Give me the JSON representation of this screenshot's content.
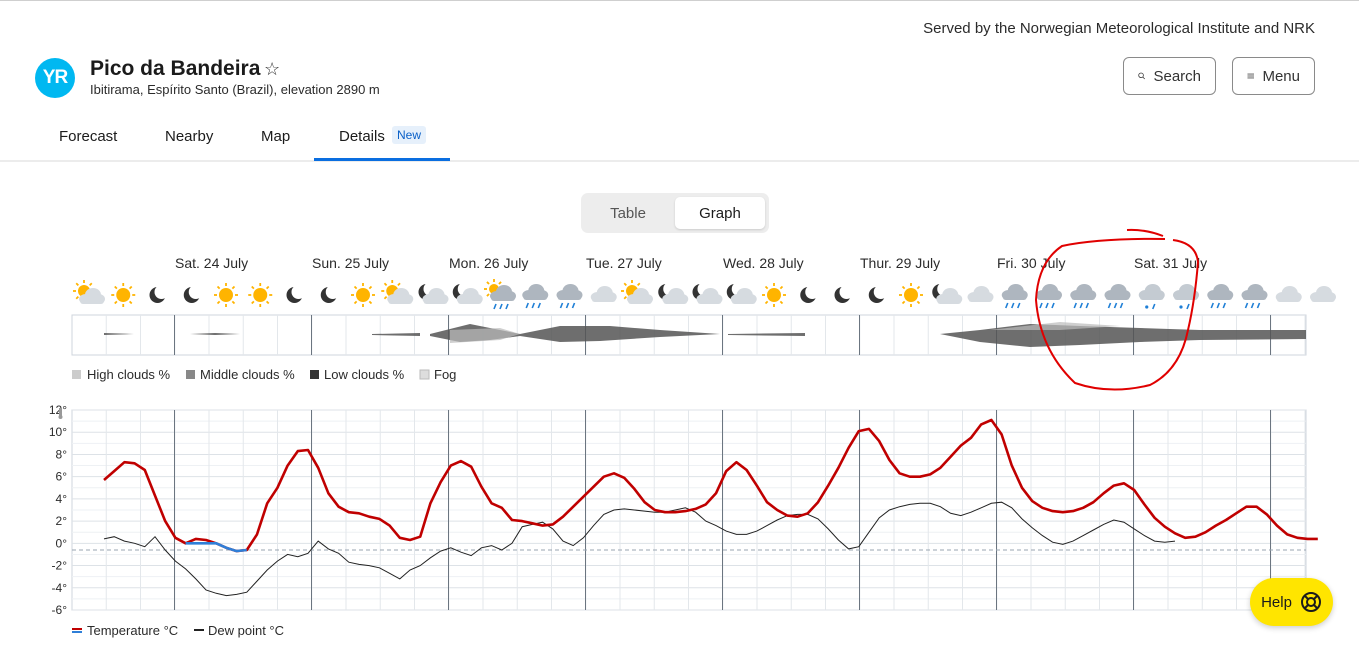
{
  "header": {
    "served_by": "Served by the Norwegian Meteorological Institute and NRK",
    "logo_text": "YR",
    "place_title": "Pico da Bandeira",
    "place_subtitle": "Ibitirama, Espírito Santo (Brazil), elevation 2890 m",
    "search_label": "Search",
    "menu_label": "Menu"
  },
  "nav": {
    "tabs": [
      {
        "label": "Forecast"
      },
      {
        "label": "Nearby"
      },
      {
        "label": "Map"
      },
      {
        "label": "Details"
      }
    ],
    "badge": "New",
    "active": "Details"
  },
  "view_toggle": {
    "table": "Table",
    "graph": "Graph",
    "selected": "Graph"
  },
  "days": [
    "Sat. 24 July",
    "Sun. 25 July",
    "Mon. 26 July",
    "Tue. 27 July",
    "Wed. 28 July",
    "Thur. 29 July",
    "Fri. 30 July",
    "Sat. 31 July"
  ],
  "symbols": [
    "partly-sunny-icon",
    "sun-icon",
    "moon-icon",
    "moon-icon",
    "sun-icon",
    "sun-icon",
    "moon-icon",
    "moon-icon",
    "sun-icon",
    "partly-sunny-icon",
    "partly-cloudy-night-icon",
    "partly-cloudy-night-icon",
    "rain-sun-icon",
    "rain-cloud-icon",
    "rain-cloud-icon",
    "cloud-icon",
    "partly-sunny-icon",
    "partly-cloudy-night-icon",
    "partly-cloudy-night-icon",
    "partly-cloudy-night-icon",
    "sun-icon",
    "moon-icon",
    "moon-icon",
    "moon-icon",
    "sun-icon",
    "partly-cloudy-night-icon",
    "cloud-icon",
    "rain-cloud-icon",
    "rain-cloud-icon",
    "rain-cloud-icon",
    "rain-cloud-icon",
    "sleet-cloud-icon",
    "sleet-cloud-icon",
    "rain-cloud-icon",
    "rain-cloud-icon",
    "cloud-icon",
    "cloud-icon"
  ],
  "cloud_legend": [
    "High clouds %",
    "Middle clouds %",
    "Low clouds %",
    "Fog"
  ],
  "chart_legend": [
    "Temperature °C",
    "Dew point °C"
  ],
  "help_label": "Help",
  "colors": {
    "temperature_warm": "#c00000",
    "temperature_cold": "#2f7fd8",
    "dew_point": "#222222",
    "accent": "#0a6ee0",
    "help": "#ffe500",
    "annotation": "#e00000"
  },
  "chart_data": {
    "type": "line",
    "ylim": [
      -6,
      12
    ],
    "yticks": [
      "12°",
      "10°",
      "8°",
      "6°",
      "4°",
      "2°",
      "0°",
      "-2°",
      "-4°",
      "-6°"
    ],
    "x_hours": [
      1,
      2,
      3,
      4,
      5,
      6,
      7,
      8,
      9,
      10,
      11,
      12,
      13,
      14,
      15,
      16,
      17,
      18,
      19,
      20,
      21,
      22,
      23,
      24,
      25,
      26,
      27,
      28,
      29,
      30,
      31,
      32,
      33,
      34,
      35,
      36,
      37,
      38,
      39,
      40,
      41,
      42,
      43,
      44,
      45,
      46,
      47,
      48,
      49,
      50,
      51,
      52,
      53,
      54,
      55,
      56,
      57,
      58,
      59,
      60,
      61,
      62,
      63,
      64,
      65,
      66,
      67,
      68,
      69,
      70,
      71,
      72,
      73,
      74,
      75,
      76,
      77,
      78,
      79,
      80,
      81,
      82,
      83,
      84,
      85,
      86,
      87,
      88,
      89,
      90,
      91,
      92,
      93,
      94,
      95,
      96,
      97,
      98,
      99,
      100,
      101,
      102,
      103,
      104,
      105,
      106,
      107,
      108,
      109,
      110,
      111,
      112,
      113,
      114,
      115,
      116,
      117,
      118,
      119,
      120,
      121,
      122,
      123,
      124,
      125,
      126,
      127,
      128,
      129,
      130,
      131,
      132,
      133,
      134,
      135,
      136,
      137,
      138,
      139,
      140,
      141,
      142,
      143,
      144,
      145,
      146,
      147,
      148,
      149,
      150,
      151,
      152,
      153,
      154,
      155,
      156,
      157,
      158,
      159,
      160,
      161,
      162,
      163,
      164,
      165,
      166,
      167,
      168,
      169,
      170,
      171,
      172,
      173,
      174,
      175,
      176,
      177,
      178,
      179,
      180,
      181,
      182,
      183,
      184,
      185,
      186,
      187,
      188,
      189,
      190,
      191,
      192,
      193,
      194,
      195,
      196,
      197,
      198,
      199,
      200,
      201,
      202,
      203,
      204,
      205,
      206,
      207,
      208,
      209,
      210,
      211,
      212,
      213,
      214,
      215,
      216
    ],
    "series": [
      {
        "name": "Temperature °C",
        "points": [
          [
            1,
            5.7
          ],
          [
            2,
            6.5
          ],
          [
            3,
            7.3
          ],
          [
            4,
            7.2
          ],
          [
            5,
            6.6
          ],
          [
            6,
            4.3
          ],
          [
            7,
            2.0
          ],
          [
            8,
            0.5
          ],
          [
            9,
            0.0
          ],
          [
            10,
            0.4
          ],
          [
            11,
            0.3
          ],
          [
            12,
            0.0
          ],
          [
            13,
            -0.4
          ],
          [
            14,
            -0.7
          ],
          [
            15,
            -0.6
          ],
          [
            16,
            0.8
          ],
          [
            17,
            3.6
          ],
          [
            18,
            5.0
          ],
          [
            19,
            7.0
          ],
          [
            20,
            8.3
          ],
          [
            21,
            8.4
          ],
          [
            22,
            6.8
          ],
          [
            23,
            4.5
          ],
          [
            24,
            3.3
          ],
          [
            25,
            2.8
          ],
          [
            26,
            2.7
          ],
          [
            27,
            2.4
          ],
          [
            28,
            2.2
          ],
          [
            29,
            1.6
          ],
          [
            30,
            0.5
          ],
          [
            31,
            0.3
          ],
          [
            32,
            0.6
          ],
          [
            33,
            3.6
          ],
          [
            34,
            5.5
          ],
          [
            35,
            7.0
          ],
          [
            36,
            7.4
          ],
          [
            37,
            6.9
          ],
          [
            38,
            5.1
          ],
          [
            39,
            3.6
          ],
          [
            40,
            3.2
          ],
          [
            41,
            2.1
          ],
          [
            42,
            2.0
          ],
          [
            43,
            1.8
          ],
          [
            44,
            1.6
          ],
          [
            45,
            1.7
          ],
          [
            46,
            2.4
          ],
          [
            47,
            3.3
          ],
          [
            48,
            4.2
          ],
          [
            49,
            5.1
          ],
          [
            50,
            6.0
          ],
          [
            51,
            6.3
          ],
          [
            52,
            5.9
          ],
          [
            53,
            4.9
          ],
          [
            54,
            3.7
          ],
          [
            55,
            3.0
          ],
          [
            56,
            2.8
          ],
          [
            57,
            2.8
          ],
          [
            58,
            2.9
          ],
          [
            59,
            3.1
          ],
          [
            60,
            3.5
          ],
          [
            61,
            4.5
          ],
          [
            62,
            6.5
          ],
          [
            63,
            7.3
          ],
          [
            64,
            6.6
          ],
          [
            65,
            5.2
          ],
          [
            66,
            3.7
          ],
          [
            67,
            3.0
          ],
          [
            68,
            2.5
          ],
          [
            69,
            2.4
          ],
          [
            70,
            2.7
          ],
          [
            71,
            3.7
          ],
          [
            72,
            5.2
          ],
          [
            73,
            6.8
          ],
          [
            74,
            8.6
          ],
          [
            75,
            10.1
          ],
          [
            76,
            10.3
          ],
          [
            77,
            9.2
          ],
          [
            78,
            7.5
          ],
          [
            79,
            6.3
          ],
          [
            80,
            6.0
          ],
          [
            81,
            6.0
          ],
          [
            82,
            6.2
          ],
          [
            83,
            6.8
          ],
          [
            84,
            7.8
          ],
          [
            85,
            8.8
          ],
          [
            86,
            9.5
          ],
          [
            87,
            10.7
          ],
          [
            88,
            11.1
          ],
          [
            89,
            9.8
          ],
          [
            90,
            7.0
          ],
          [
            91,
            5.0
          ],
          [
            92,
            3.8
          ],
          [
            93,
            3.2
          ],
          [
            94,
            2.9
          ],
          [
            95,
            2.8
          ],
          [
            96,
            2.9
          ],
          [
            97,
            3.2
          ],
          [
            98,
            3.7
          ],
          [
            99,
            4.5
          ],
          [
            100,
            5.2
          ],
          [
            101,
            5.4
          ],
          [
            102,
            4.8
          ],
          [
            103,
            3.5
          ],
          [
            104,
            2.3
          ],
          [
            105,
            1.5
          ],
          [
            106,
            0.9
          ],
          [
            107,
            0.5
          ],
          [
            108,
            0.6
          ],
          [
            109,
            1.0
          ],
          [
            110,
            1.6
          ],
          [
            111,
            2.1
          ],
          [
            112,
            2.7
          ],
          [
            113,
            3.3
          ],
          [
            114,
            3.3
          ],
          [
            115,
            2.6
          ],
          [
            116,
            1.6
          ],
          [
            117,
            0.8
          ],
          [
            118,
            0.5
          ],
          [
            119,
            0.4
          ],
          [
            120,
            0.4
          ]
        ]
      },
      {
        "name": "Dew point °C",
        "points": [
          [
            1,
            0.4
          ],
          [
            2,
            0.6
          ],
          [
            3,
            0.2
          ],
          [
            4,
            0.0
          ],
          [
            5,
            -0.3
          ],
          [
            6,
            0.6
          ],
          [
            7,
            -0.6
          ],
          [
            8,
            -1.6
          ],
          [
            9,
            -2.3
          ],
          [
            10,
            -3.2
          ],
          [
            11,
            -4.2
          ],
          [
            12,
            -4.5
          ],
          [
            13,
            -4.7
          ],
          [
            14,
            -4.6
          ],
          [
            15,
            -4.4
          ],
          [
            16,
            -3.4
          ],
          [
            17,
            -2.4
          ],
          [
            18,
            -1.6
          ],
          [
            19,
            -1.0
          ],
          [
            20,
            -1.2
          ],
          [
            21,
            -0.9
          ],
          [
            22,
            0.2
          ],
          [
            23,
            -0.5
          ],
          [
            24,
            -0.9
          ],
          [
            25,
            -1.7
          ],
          [
            26,
            -1.9
          ],
          [
            27,
            -2.0
          ],
          [
            28,
            -2.2
          ],
          [
            29,
            -2.7
          ],
          [
            30,
            -3.2
          ],
          [
            31,
            -2.4
          ],
          [
            32,
            -2.0
          ],
          [
            33,
            -1.3
          ],
          [
            34,
            -0.7
          ],
          [
            35,
            -0.4
          ],
          [
            36,
            -0.8
          ],
          [
            37,
            -1.1
          ],
          [
            38,
            -0.4
          ],
          [
            39,
            -0.2
          ],
          [
            40,
            -0.6
          ],
          [
            41,
            0.0
          ],
          [
            42,
            1.5
          ],
          [
            43,
            1.7
          ],
          [
            44,
            1.9
          ],
          [
            45,
            1.3
          ],
          [
            46,
            0.2
          ],
          [
            47,
            -0.2
          ],
          [
            48,
            0.5
          ],
          [
            49,
            1.6
          ],
          [
            50,
            2.6
          ],
          [
            51,
            3.0
          ],
          [
            52,
            3.1
          ],
          [
            53,
            3.0
          ],
          [
            54,
            2.9
          ],
          [
            55,
            2.8
          ],
          [
            56,
            2.8
          ],
          [
            57,
            3.0
          ],
          [
            58,
            3.2
          ],
          [
            59,
            2.8
          ],
          [
            60,
            2.0
          ],
          [
            61,
            1.6
          ],
          [
            62,
            1.1
          ],
          [
            63,
            0.8
          ],
          [
            64,
            0.8
          ],
          [
            65,
            1.1
          ],
          [
            66,
            1.6
          ],
          [
            67,
            2.1
          ],
          [
            68,
            2.5
          ],
          [
            69,
            2.6
          ],
          [
            70,
            2.6
          ],
          [
            71,
            2.2
          ],
          [
            72,
            1.3
          ],
          [
            73,
            0.3
          ],
          [
            74,
            -0.5
          ],
          [
            75,
            -0.3
          ],
          [
            76,
            1.0
          ],
          [
            77,
            2.3
          ],
          [
            78,
            3.0
          ],
          [
            79,
            3.3
          ],
          [
            80,
            3.5
          ],
          [
            81,
            3.6
          ],
          [
            82,
            3.6
          ],
          [
            83,
            3.3
          ],
          [
            84,
            2.7
          ],
          [
            85,
            2.5
          ],
          [
            86,
            2.8
          ],
          [
            87,
            3.2
          ],
          [
            88,
            3.6
          ],
          [
            89,
            3.7
          ],
          [
            90,
            3.2
          ],
          [
            91,
            2.2
          ],
          [
            92,
            1.4
          ],
          [
            93,
            0.7
          ],
          [
            94,
            0.1
          ],
          [
            95,
            -0.1
          ],
          [
            96,
            0.2
          ],
          [
            97,
            0.7
          ],
          [
            98,
            1.2
          ],
          [
            99,
            1.7
          ],
          [
            100,
            2.1
          ],
          [
            101,
            1.9
          ],
          [
            102,
            1.3
          ],
          [
            103,
            0.7
          ],
          [
            104,
            0.2
          ],
          [
            105,
            0.1
          ],
          [
            106,
            0.2
          ]
        ]
      }
    ]
  }
}
